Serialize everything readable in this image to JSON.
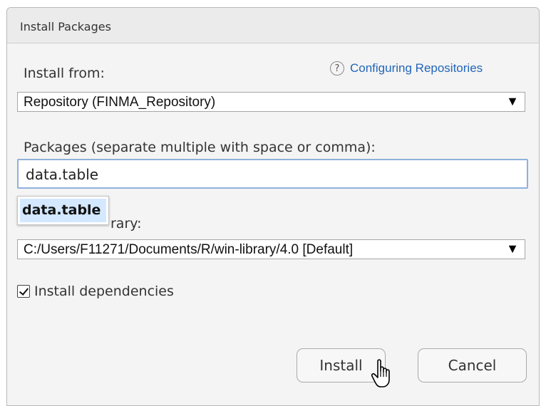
{
  "dialog": {
    "title": "Install Packages"
  },
  "install_from": {
    "label": "Install from:",
    "help_link": "Configuring Repositories",
    "help_icon": "?",
    "selected": "Repository (FINMA_Repository)"
  },
  "packages": {
    "label": "Packages (separate multiple with space or comma):",
    "value": "data.table",
    "autocomplete": [
      "data.table"
    ]
  },
  "library": {
    "label_visible_part": "rary:",
    "selected": "C:/Users/F11271/Documents/R/win-library/4.0 [Default]"
  },
  "dependencies": {
    "label": "Install dependencies",
    "checked": true
  },
  "buttons": {
    "install": "Install",
    "cancel": "Cancel"
  },
  "colors": {
    "link": "#2266b8",
    "input_focus_border": "#8fb1dc",
    "autocomplete_highlight": "#d4e8ff"
  }
}
